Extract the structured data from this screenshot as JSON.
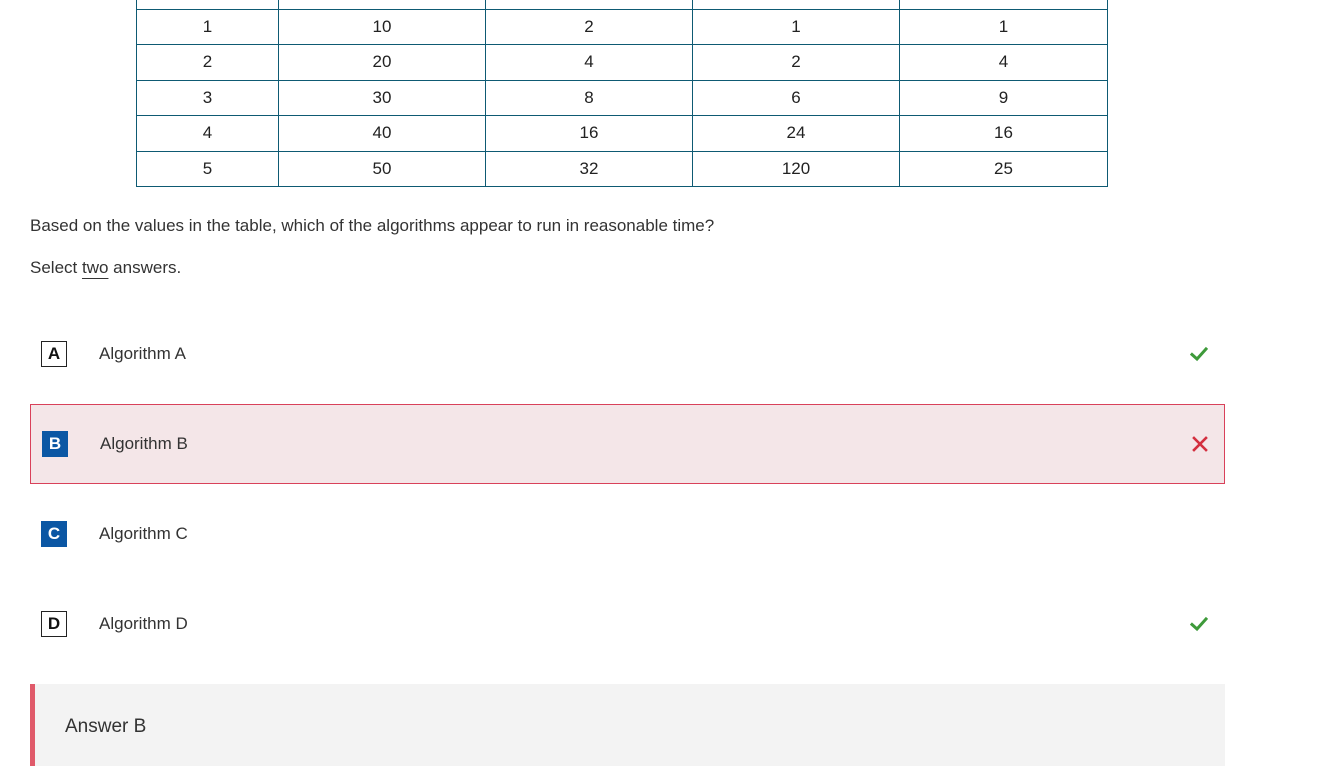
{
  "table": {
    "rows": [
      [
        "1",
        "10",
        "2",
        "1",
        "1"
      ],
      [
        "2",
        "20",
        "4",
        "2",
        "4"
      ],
      [
        "3",
        "30",
        "8",
        "6",
        "9"
      ],
      [
        "4",
        "40",
        "16",
        "24",
        "16"
      ],
      [
        "5",
        "50",
        "32",
        "120",
        "25"
      ]
    ]
  },
  "question": {
    "text": "Based on the values in the table, which of the algorithms appear to run in reasonable time?",
    "instruction_prefix": "Select ",
    "instruction_emphasis": "two",
    "instruction_suffix": " answers."
  },
  "options": [
    {
      "letter": "A",
      "label": "Algorithm A",
      "selected": false,
      "status": "correct"
    },
    {
      "letter": "B",
      "label": "Algorithm B",
      "selected": true,
      "status": "incorrect"
    },
    {
      "letter": "C",
      "label": "Algorithm C",
      "selected": true,
      "status": "none"
    },
    {
      "letter": "D",
      "label": "Algorithm D",
      "selected": false,
      "status": "correct"
    }
  ],
  "answer": {
    "text": "Answer B"
  },
  "colors": {
    "table_border": "#0e5a73",
    "selected_letter": "#0b57a4",
    "correct_mark": "#3e9a3a",
    "incorrect_mark": "#d32f3f",
    "incorrect_bg": "#f4e6e8",
    "answer_accent": "#e05a6a"
  },
  "icons": {
    "correct": "checkmark-icon",
    "incorrect": "x-mark-icon"
  }
}
